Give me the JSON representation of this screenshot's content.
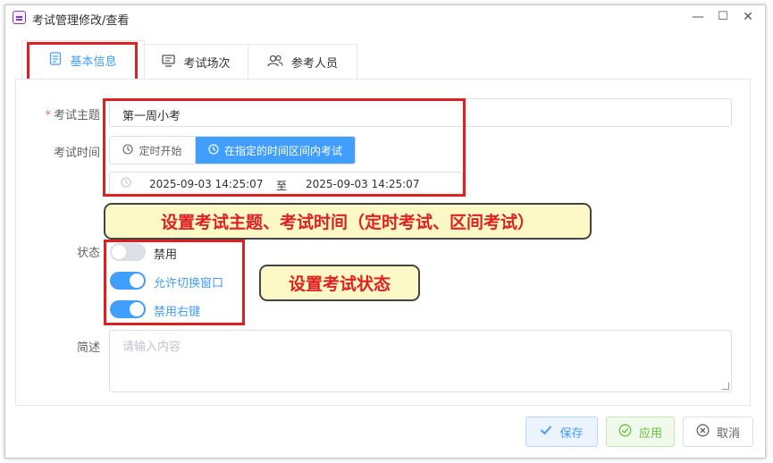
{
  "window": {
    "title": "考试管理修改/查看",
    "minimize": "—",
    "maximize": "☐",
    "close": "✕"
  },
  "tabs": [
    {
      "label": "基本信息",
      "icon": "document-icon",
      "active": true
    },
    {
      "label": "考试场次",
      "icon": "monitor-icon",
      "active": false
    },
    {
      "label": "参考人员",
      "icon": "users-icon",
      "active": false
    }
  ],
  "form": {
    "subject_label": "考试主题",
    "subject_required_mark": "*",
    "subject_value": "第一周小考",
    "time_label": "考试时间",
    "time_mode_scheduled": "定时开始",
    "time_mode_range": "在指定的时间区间内考试",
    "time_mode_selected": "在指定的时间区间内考试",
    "range_start": "2025-09-03 14:25:07",
    "range_separator": "至",
    "range_end": "2025-09-03 14:25:07",
    "status_label": "状态",
    "switches": [
      {
        "label": "禁用",
        "on": false
      },
      {
        "label": "允许切换窗口",
        "on": true
      },
      {
        "label": "禁用右键",
        "on": true
      }
    ],
    "desc_label": "简述",
    "desc_placeholder": "请输入内容"
  },
  "callouts": {
    "subject_time": "设置考试主题、考试时间（定时考试、区间考试）",
    "status": "设置考试状态"
  },
  "footer": {
    "save": "保存",
    "apply": "应用",
    "cancel": "取消"
  },
  "colors": {
    "primary": "#409eff",
    "success": "#67c23a",
    "annotation_red": "#e02020",
    "callout_bg": "#fdf9c6"
  }
}
